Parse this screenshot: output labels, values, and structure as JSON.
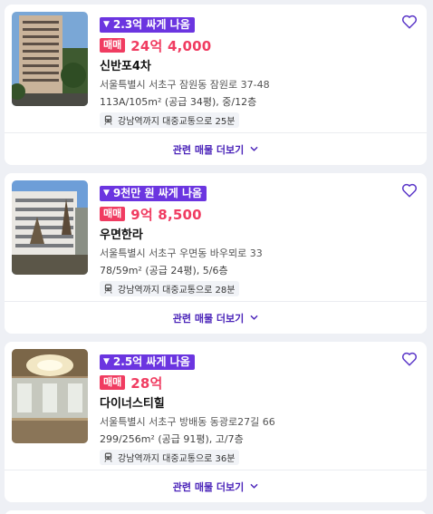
{
  "listings": [
    {
      "discount_label": "2.3억 싸게 나옴",
      "deal_type": "매매",
      "price": "24억 4,000",
      "name": "신반포4차",
      "address": "서울특별시 서초구 잠원동 잠원로 37-48",
      "spec": "113A/105m² (공급 34평), 중/12층",
      "transit": "강남역까지 대중교통으로 25분",
      "more_label": "관련 매물 더보기",
      "thumbnail": "apartment-building-photo"
    },
    {
      "discount_label": "9천만 원 싸게 나옴",
      "deal_type": "매매",
      "price": "9억 8,500",
      "name": "우면한라",
      "address": "서울특별시 서초구 우면동 바우뫼로 33",
      "spec": "78/59m² (공급 24평), 5/6층",
      "transit": "강남역까지 대중교통으로 28분",
      "more_label": "관련 매물 더보기",
      "thumbnail": "apartment-building-photo"
    },
    {
      "discount_label": "2.5억 싸게 나옴",
      "deal_type": "매매",
      "price": "28억",
      "name": "다이너스티힐",
      "address": "서울특별시 서초구 방배동 동광로27길 66",
      "spec": "299/256m² (공급 91평), 고/7층",
      "transit": "강남역까지 대중교통으로 36분",
      "more_label": "관련 매물 더보기",
      "thumbnail": "interior-hall-photo"
    }
  ],
  "colors": {
    "discount_badge": "#6b35e0",
    "price": "#f03c61",
    "more_link": "#4a23b9",
    "heart": "#5a36c8"
  },
  "icons": [
    "down-arrow-icon",
    "train-icon",
    "heart-icon",
    "chevron-down-icon"
  ]
}
